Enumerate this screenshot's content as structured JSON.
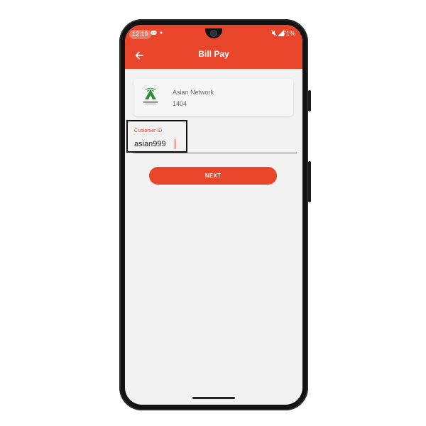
{
  "status_bar": {
    "time": "12:19",
    "notification_icons": [
      "discord-icon",
      "dot-icon"
    ],
    "system_icons": [
      "mute-icon",
      "signal-icon"
    ],
    "battery": "71%"
  },
  "app_bar": {
    "title": "Bill Pay",
    "back_icon": "arrow-left-icon"
  },
  "biller": {
    "name": "Asian Network",
    "code": "1404",
    "logo_icon": "asian-network-logo",
    "logo_color": "#2e8b3d"
  },
  "customer_id_field": {
    "label": "Customer ID",
    "value": "asian999"
  },
  "next_button": {
    "label": "NEXT"
  },
  "colors": {
    "accent": "#e8452a",
    "background": "#f2f2f2",
    "card": "#f7f7f7"
  }
}
